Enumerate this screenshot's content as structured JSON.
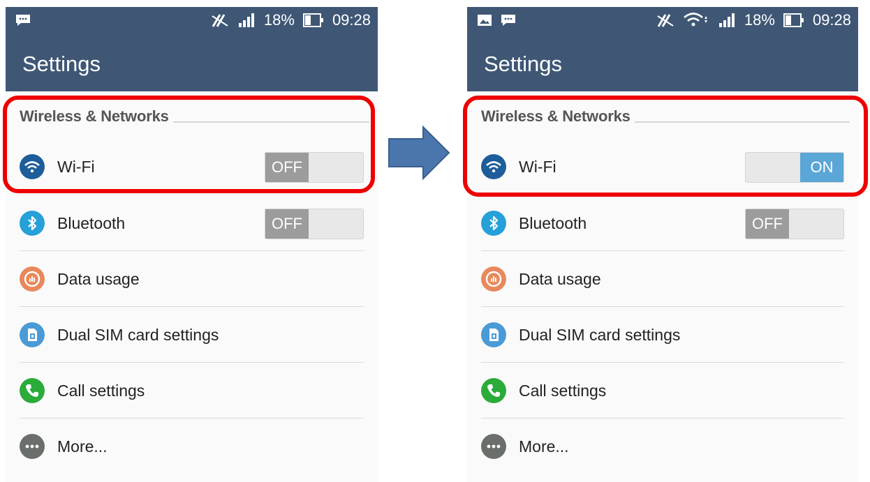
{
  "arrow_color": "#4a76ad",
  "highlight_color": "#ee0000",
  "screens": [
    {
      "status": {
        "battery": "18%",
        "time": "09:28"
      },
      "title": "Settings",
      "section": "Wireless & Networks",
      "items": [
        {
          "label": "Wi-Fi",
          "icon": "wifi-icon",
          "toggle": "OFF"
        },
        {
          "label": "Bluetooth",
          "icon": "bluetooth-icon",
          "toggle": "OFF"
        },
        {
          "label": "Data usage",
          "icon": "data-usage-icon"
        },
        {
          "label": "Dual SIM card settings",
          "icon": "sim-card-icon"
        },
        {
          "label": "Call settings",
          "icon": "phone-icon"
        },
        {
          "label": "More...",
          "icon": "more-icon"
        }
      ]
    },
    {
      "status": {
        "battery": "18%",
        "time": "09:28"
      },
      "title": "Settings",
      "section": "Wireless & Networks",
      "items": [
        {
          "label": "Wi-Fi",
          "icon": "wifi-icon",
          "toggle": "ON"
        },
        {
          "label": "Bluetooth",
          "icon": "bluetooth-icon",
          "toggle": "OFF"
        },
        {
          "label": "Data usage",
          "icon": "data-usage-icon"
        },
        {
          "label": "Dual SIM card settings",
          "icon": "sim-card-icon"
        },
        {
          "label": "Call settings",
          "icon": "phone-icon"
        },
        {
          "label": "More...",
          "icon": "more-icon"
        }
      ]
    }
  ]
}
